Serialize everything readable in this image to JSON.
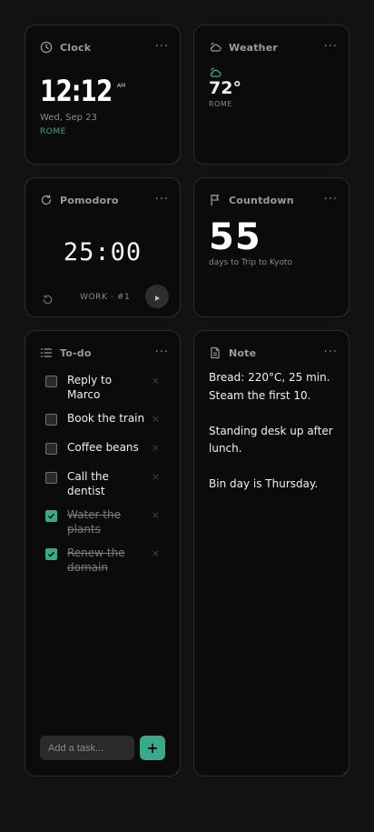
{
  "widgets": {
    "clock": {
      "title": "Clock",
      "time": "12:12",
      "ampm": "AM",
      "date": "Wed, Sep 23",
      "city": "ROME"
    },
    "weather": {
      "title": "Weather",
      "temp": "72°",
      "city": "ROME",
      "icon": "cloud-sun-icon"
    },
    "pomodoro": {
      "title": "Pomodoro",
      "time": "25:00",
      "label": "WORK · #1"
    },
    "countdown": {
      "title": "Countdown",
      "value": "55",
      "caption": "days to Trip to Kyoto"
    },
    "todo": {
      "title": "To-do",
      "items": [
        {
          "text": "Reply to Marco",
          "done": false
        },
        {
          "text": "Book the train",
          "done": false
        },
        {
          "text": "Coffee beans",
          "done": false
        },
        {
          "text": "Call the dentist",
          "done": false
        },
        {
          "text": "Water the plants",
          "done": true
        },
        {
          "text": "Renew the domain",
          "done": true
        }
      ],
      "add_placeholder": "Add a task...",
      "add_label": "+",
      "remove_label": "×"
    },
    "note": {
      "title": "Note",
      "paragraphs": [
        "Bread: 220°C, 25 min. Steam the first 10.",
        "Standing desk up after lunch.",
        "Bin day is Thursday."
      ]
    }
  },
  "more_label": "···",
  "colors": {
    "accent": "#3aa98a",
    "background": "#121212",
    "card": "#0b0b0b"
  }
}
